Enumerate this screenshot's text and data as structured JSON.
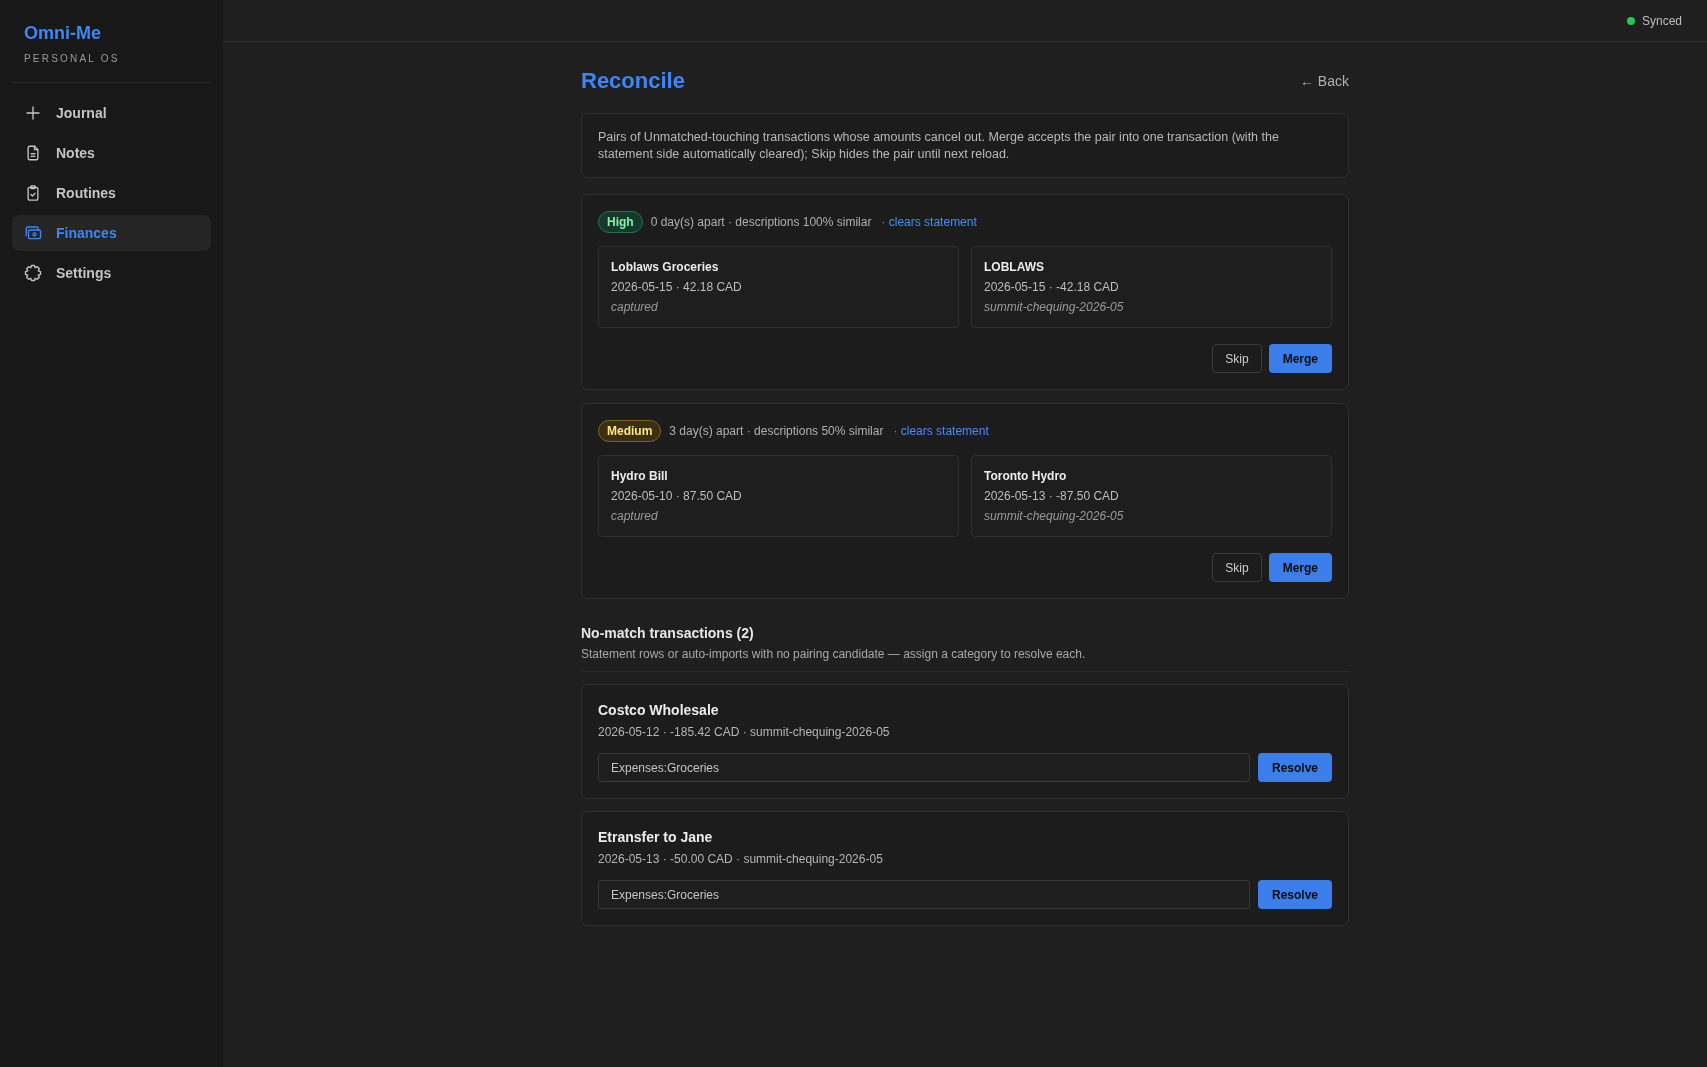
{
  "sidebar": {
    "brand": {
      "name": "Omni-Me",
      "tagline": "PERSONAL OS"
    },
    "items": [
      {
        "label": "Journal",
        "selected": false
      },
      {
        "label": "Notes",
        "selected": false
      },
      {
        "label": "Routines",
        "selected": false
      },
      {
        "label": "Finances",
        "selected": true
      },
      {
        "label": "Settings",
        "selected": false
      }
    ]
  },
  "top_bar": {
    "sync_status": "Synced"
  },
  "page": {
    "title": "Reconcile",
    "back_link": "← Back",
    "description": "Pairs of Unmatched-touching transactions whose amounts cancel out. Merge accepts the pair into one transaction (with the statement side automatically cleared); Skip hides the pair until next reload."
  },
  "pairs": [
    {
      "confidence": {
        "label": "High",
        "kind": "high"
      },
      "detail": "0 day(s) apart · descriptions 100% similar",
      "note": "· clears statement",
      "left": {
        "title": "Loblaws Groceries",
        "meta": "2026-05-15 · 42.18 CAD",
        "source": "captured"
      },
      "right": {
        "title": "LOBLAWS",
        "meta": "2026-05-15 · -42.18 CAD",
        "source": "summit-chequing-2026-05"
      },
      "buttons": [
        {
          "label": "Skip",
          "kind": "skip"
        },
        {
          "label": "Merge",
          "kind": "merge"
        }
      ]
    },
    {
      "confidence": {
        "label": "Medium",
        "kind": "medium"
      },
      "detail": "3 day(s) apart · descriptions 50% similar",
      "note": "· clears statement",
      "left": {
        "title": "Hydro Bill",
        "meta": "2026-05-10 · 87.50 CAD",
        "source": "captured"
      },
      "right": {
        "title": "Toronto Hydro",
        "meta": "2026-05-13 · -87.50 CAD",
        "source": "summit-chequing-2026-05"
      },
      "buttons": [
        {
          "label": "Skip",
          "kind": "skip"
        },
        {
          "label": "Merge",
          "kind": "merge"
        }
      ]
    }
  ],
  "no_match": {
    "heading": "No-match transactions (2)",
    "subtitle": "Statement rows or auto-imports with no pairing candidate — assign a category to resolve each.",
    "items": [
      {
        "title": "Costco Wholesale",
        "meta": "2026-05-12 · -185.42 CAD · summit-chequing-2026-05",
        "category": "Expenses:Groceries",
        "button": "Resolve"
      },
      {
        "title": "Etransfer to Jane",
        "meta": "2026-05-13 · -50.00 CAD · summit-chequing-2026-05",
        "category": "Expenses:Groceries",
        "button": "Resolve"
      }
    ]
  }
}
